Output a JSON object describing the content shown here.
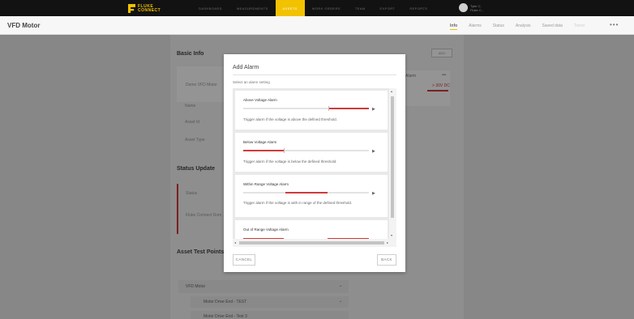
{
  "brand": {
    "line1": "FLUKE",
    "line2": "CONNECT"
  },
  "nav": {
    "items": [
      {
        "label": "DASHBOARD",
        "active": false
      },
      {
        "label": "MEASUREMENTS",
        "active": false
      },
      {
        "label": "ASSETS",
        "active": true
      },
      {
        "label": "WORK ORDERS",
        "active": false
      },
      {
        "label": "TEAM",
        "active": false
      },
      {
        "label": "EXPORT",
        "active": false
      },
      {
        "label": "REPORTS",
        "active": false
      }
    ],
    "user": {
      "line1": "Tyler C.",
      "line2": "Fluke C..."
    }
  },
  "page": {
    "title": "VFD Motor"
  },
  "tabs": [
    {
      "label": "Info",
      "state": "active"
    },
    {
      "label": "Alarms",
      "state": "normal"
    },
    {
      "label": "Status",
      "state": "normal"
    },
    {
      "label": "Analysis",
      "state": "normal"
    },
    {
      "label": "Saved data",
      "state": "normal"
    },
    {
      "label": "Trend",
      "state": "disabled"
    }
  ],
  "background": {
    "basic_info": {
      "title": "Basic Info",
      "thumb_label": "Demo VFD Motor",
      "fields": [
        "Name",
        "Asset Id",
        "Asset Type"
      ],
      "add_label": "ADD"
    },
    "alarm_card": {
      "title": "Alarm",
      "value": "> 30V DC"
    },
    "status_update": {
      "title": "Status Update",
      "fields": [
        "Status",
        "Fluke Connect Dom"
      ]
    },
    "test_points": {
      "title": "Asset Test Points",
      "root": "VFD Motor",
      "children": [
        "Motor Drive End - TEST",
        "Motor Drive End - Test 3"
      ]
    }
  },
  "modal": {
    "title": "Add Alarm",
    "subtitle": "Select an alarm setting",
    "options": [
      {
        "title": "Above Voltage Alarm",
        "description": "Trigger alarm if the voltage is above the defined threshold."
      },
      {
        "title": "Below Voltage Alarm",
        "description": "Trigger alarm if the voltage is below the defined threshold."
      },
      {
        "title": "Within Range Voltage Alarm",
        "description": "Trigger alarm if the voltage is with in range of the defined threshold."
      },
      {
        "title": "Out of Range Voltage Alarm",
        "description": ""
      }
    ],
    "cancel_label": "CANCEL",
    "back_label": "BACK"
  },
  "colors": {
    "accent": "#f2c200",
    "alarm_red": "#d23a3a",
    "nav_bg": "#121212"
  }
}
